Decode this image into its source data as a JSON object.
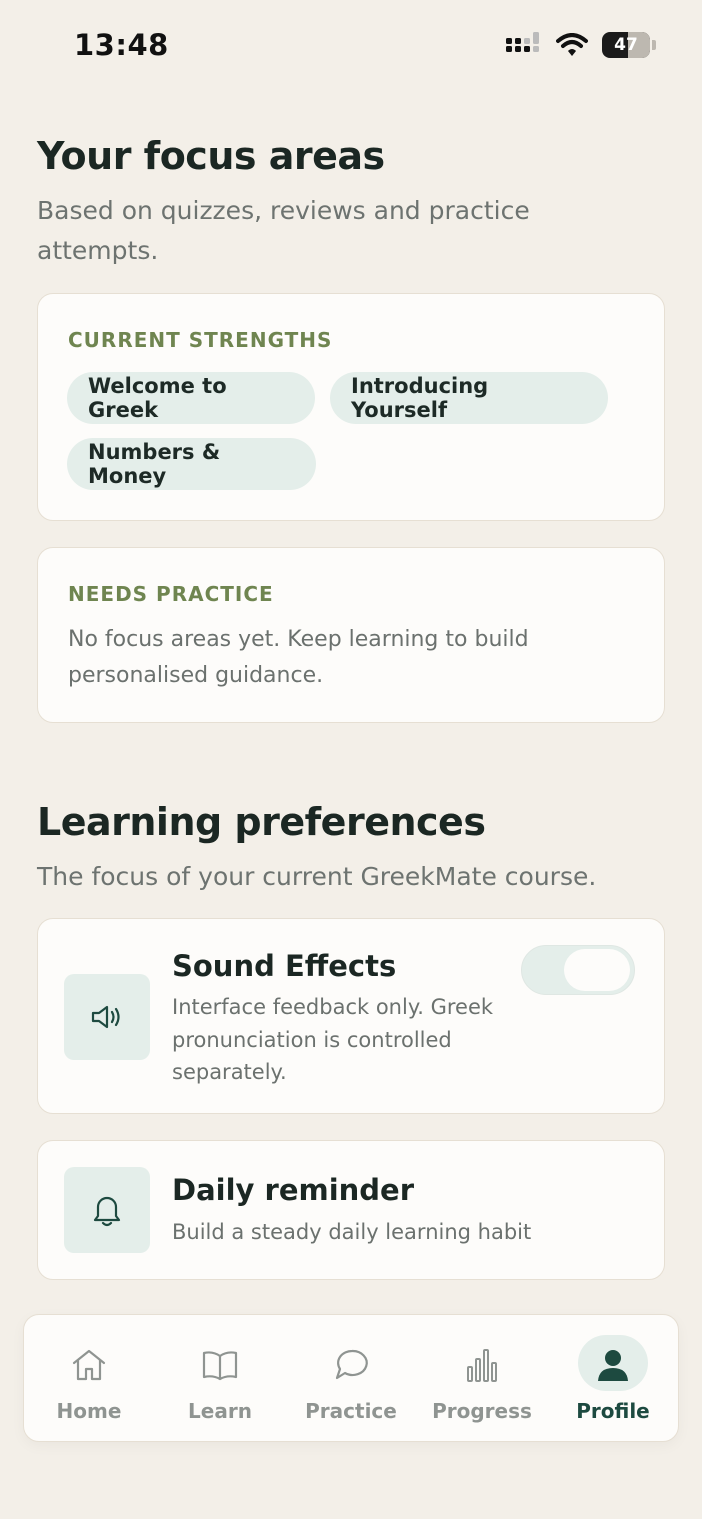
{
  "status": {
    "time": "13:48",
    "battery": "47"
  },
  "focus": {
    "title": "Your focus areas",
    "subtitle": "Based on quizzes, reviews and practice attempts.",
    "strengths": {
      "label": "CURRENT STRENGTHS",
      "chips": [
        "Welcome to Greek",
        "Introducing Yourself",
        "Numbers & Money"
      ]
    },
    "needs": {
      "label": "NEEDS PRACTICE",
      "text": "No focus areas yet. Keep learning to build personalised guidance."
    }
  },
  "prefs": {
    "title": "Learning preferences",
    "subtitle": "The focus of your current GreekMate course.",
    "sound": {
      "title": "Sound Effects",
      "desc": "Interface feedback only. Greek pronunciation is controlled separately.",
      "enabled": false
    },
    "reminder": {
      "title": "Daily reminder",
      "desc": "Build a steady daily learning habit"
    }
  },
  "tabs": [
    {
      "label": "Home",
      "icon": "home-icon",
      "active": false
    },
    {
      "label": "Learn",
      "icon": "book-icon",
      "active": false
    },
    {
      "label": "Practice",
      "icon": "chat-icon",
      "active": false
    },
    {
      "label": "Progress",
      "icon": "bar-chart-icon",
      "active": false
    },
    {
      "label": "Profile",
      "icon": "user-icon",
      "active": true
    }
  ],
  "colors": {
    "accent": "#1d4a40",
    "label": "#6f8550",
    "chip": "#e4eeea",
    "background": "#f3efe8"
  }
}
